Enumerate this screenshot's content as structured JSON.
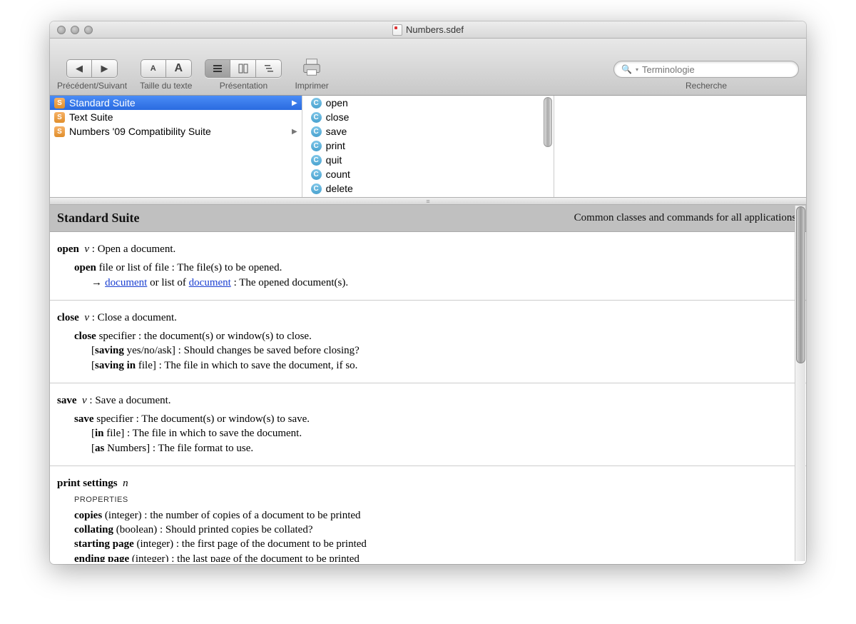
{
  "window": {
    "title": "Numbers.sdef"
  },
  "toolbar": {
    "nav_label": "Précédent/Suivant",
    "textsize_label": "Taille du texte",
    "view_label": "Présentation",
    "print_label": "Imprimer",
    "search_label": "Recherche",
    "search_placeholder": "Terminologie"
  },
  "suites": [
    {
      "name": "Standard Suite",
      "selected": true,
      "has_children": true
    },
    {
      "name": "Text Suite",
      "selected": false,
      "has_children": false
    },
    {
      "name": "Numbers '09 Compatibility Suite",
      "selected": false,
      "has_children": true
    }
  ],
  "commands": [
    {
      "name": "open"
    },
    {
      "name": "close"
    },
    {
      "name": "save"
    },
    {
      "name": "print"
    },
    {
      "name": "quit"
    },
    {
      "name": "count"
    },
    {
      "name": "delete"
    }
  ],
  "detail": {
    "title": "Standard Suite",
    "subtitle": "Common classes and commands for all applications.",
    "open": {
      "head": "open",
      "kind": "v",
      "desc": "Open a document.",
      "sig": "open",
      "sig_rest": " file or list of file : The file(s) to be opened.",
      "ret_a": "document",
      "ret_mid": " or list of ",
      "ret_b": "document",
      "ret_rest": " : The opened document(s)."
    },
    "close": {
      "head": "close",
      "kind": "v",
      "desc": "Close a document.",
      "sig": "close",
      "sig_rest": " specifier : the document(s) or window(s) to close.",
      "p1a": "saving",
      "p1b": " yes/no/ask] : Should changes be saved before closing?",
      "p2a": "saving in",
      "p2b": " file] : The file in which to save the document, if so."
    },
    "save": {
      "head": "save",
      "kind": "v",
      "desc": "Save a document.",
      "sig": "save",
      "sig_rest": " specifier : The document(s) or window(s) to save.",
      "p1a": "in",
      "p1b": " file] : The file in which to save the document.",
      "p2a": "as",
      "p2b": " Numbers] : The file format to use."
    },
    "printsettings": {
      "head": "print settings",
      "kind": "n",
      "props_label": "PROPERTIES",
      "r1a": "copies",
      "r1b": " (integer) : the number of copies of a document to be printed",
      "r2a": "collating",
      "r2b": " (boolean) : Should printed copies be collated?",
      "r3a": "starting page",
      "r3b": " (integer) : the first page of the document to be printed",
      "r4a": "ending page",
      "r4b": " (integer) : the last page of the document to be printed"
    }
  }
}
